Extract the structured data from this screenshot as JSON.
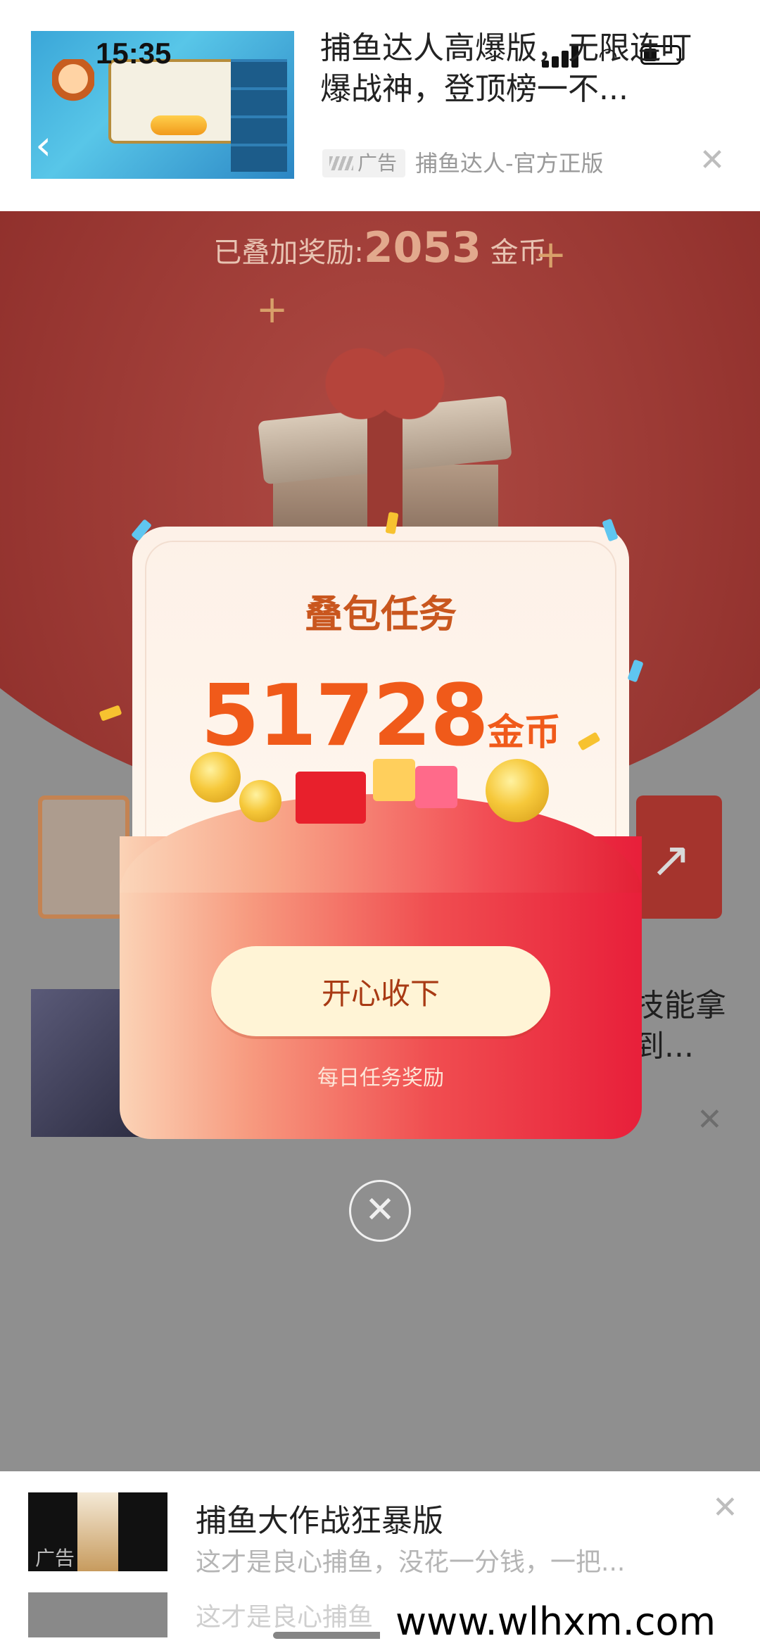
{
  "status_bar": {
    "time": "15:35"
  },
  "top_ad": {
    "title": "捕鱼达人高爆版，无限连叮爆战神，登顶榜一不...",
    "badge": "广告",
    "source": "捕鱼达人-官方正版"
  },
  "background": {
    "bonus_prefix": "已叠加奖励:",
    "bonus_value": "2053",
    "bonus_unit": "金币",
    "ad_text": "技能拿到..."
  },
  "modal": {
    "title": "叠包任务",
    "amount": "51728",
    "amount_unit": "金币",
    "confirm_label": "开心收下",
    "subtitle": "每日任务奖励"
  },
  "bottom_ad": {
    "title": "捕鱼大作战狂暴版",
    "desc": "这才是良心捕鱼，没花一分钱，一把...",
    "badge": "广告",
    "ghost_desc": "这才是良心捕鱼"
  },
  "watermark": "www.wlhxm.com"
}
